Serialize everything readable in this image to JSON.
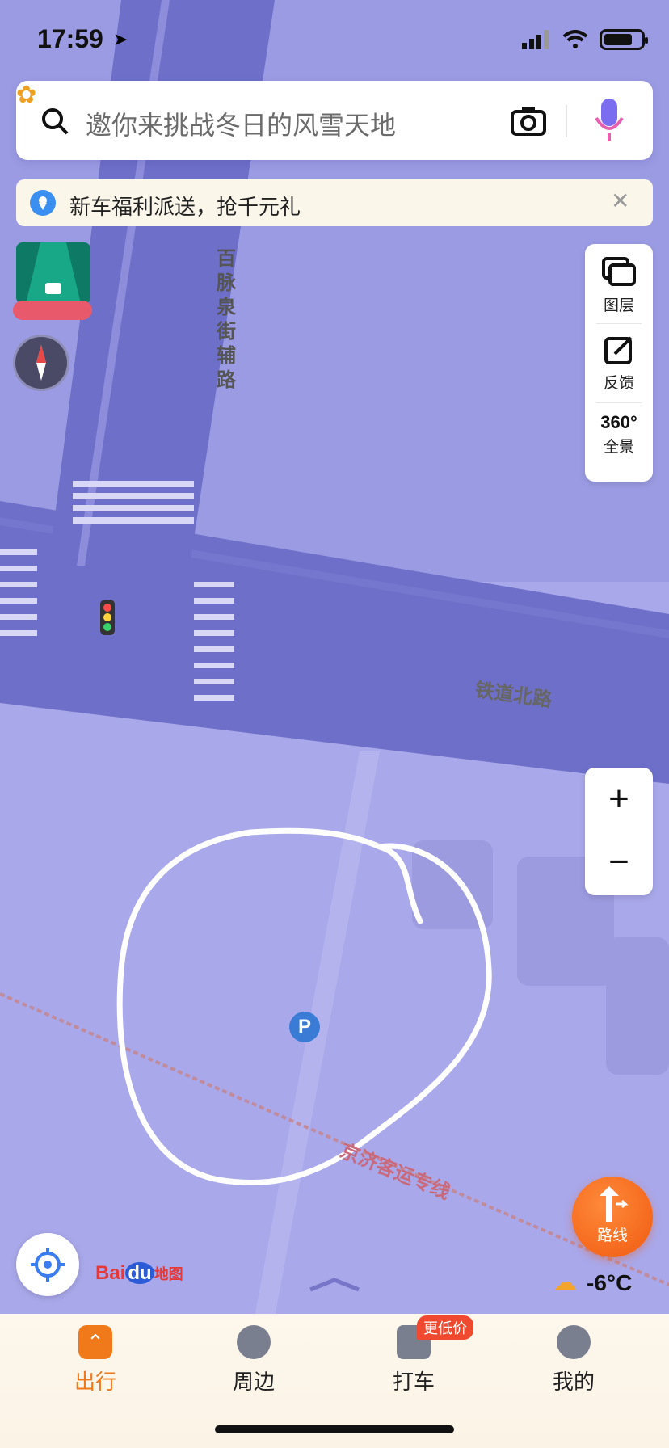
{
  "status_bar": {
    "time": "17:59"
  },
  "search": {
    "placeholder": "邀你来挑战冬日的风雪天地"
  },
  "banner": {
    "text": "新车福利派送，抢千元礼"
  },
  "tools": [
    {
      "label": "图层",
      "icon": "layers-icon"
    },
    {
      "label": "反馈",
      "icon": "feedback-icon"
    },
    {
      "label": "全景",
      "icon": "panorama-360-icon",
      "badge": "360°"
    }
  ],
  "zoom": {
    "in_label": "+",
    "out_label": "−"
  },
  "map": {
    "roads": [
      "百脉泉街辅路",
      "铁道北路",
      "京济客运专线"
    ],
    "poi_parking": "P",
    "logo_text": "Bai",
    "logo_text2": "du",
    "logo_cn": "地图"
  },
  "route_button": {
    "label": "路线"
  },
  "weather": {
    "temperature": "-6°C"
  },
  "bottom_nav": [
    {
      "label": "出行",
      "active": true
    },
    {
      "label": "周边",
      "active": false
    },
    {
      "label": "打车",
      "active": false,
      "badge": "更低价"
    },
    {
      "label": "我的",
      "active": false
    }
  ],
  "colors": {
    "accent": "#f07a1a",
    "map_bg": "#a7a6e8",
    "road": "#6e6fc9"
  }
}
